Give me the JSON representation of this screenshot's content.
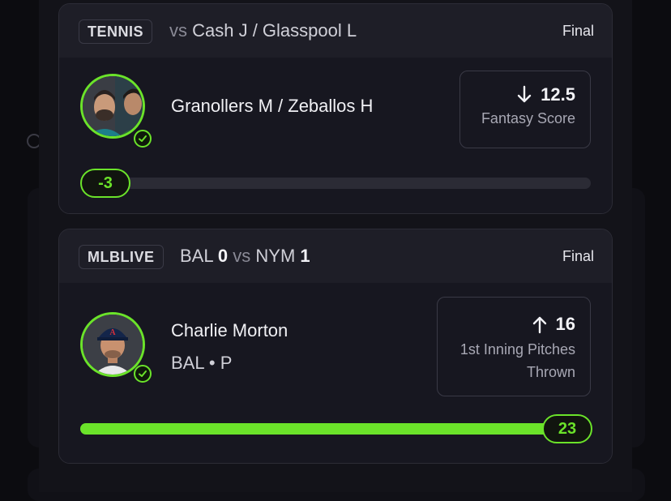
{
  "accent_color": "#6be32a",
  "cards": [
    {
      "league_tag": "TENNIS",
      "matchup": {
        "vs": "vs",
        "text": "Cash J / Glasspool L"
      },
      "status": "Final",
      "player": {
        "name": "Granollers M / Zeballos H",
        "sub": ""
      },
      "stat": {
        "direction": "down",
        "value": "12.5",
        "label": "Fantasy Score"
      },
      "progress": {
        "current": "-3",
        "fraction": 0.0
      }
    },
    {
      "league_tag": "MLBLIVE",
      "matchup": {
        "team1": "BAL",
        "score1": "0",
        "vs": "vs",
        "team2": "NYM",
        "score2": "1"
      },
      "status": "Final",
      "player": {
        "name": "Charlie Morton",
        "sub": "BAL • P"
      },
      "stat": {
        "direction": "up",
        "value": "16",
        "label_line1": "1st Inning Pitches",
        "label_line2": "Thrown"
      },
      "progress": {
        "current": "23",
        "fraction": 1.0
      }
    }
  ]
}
